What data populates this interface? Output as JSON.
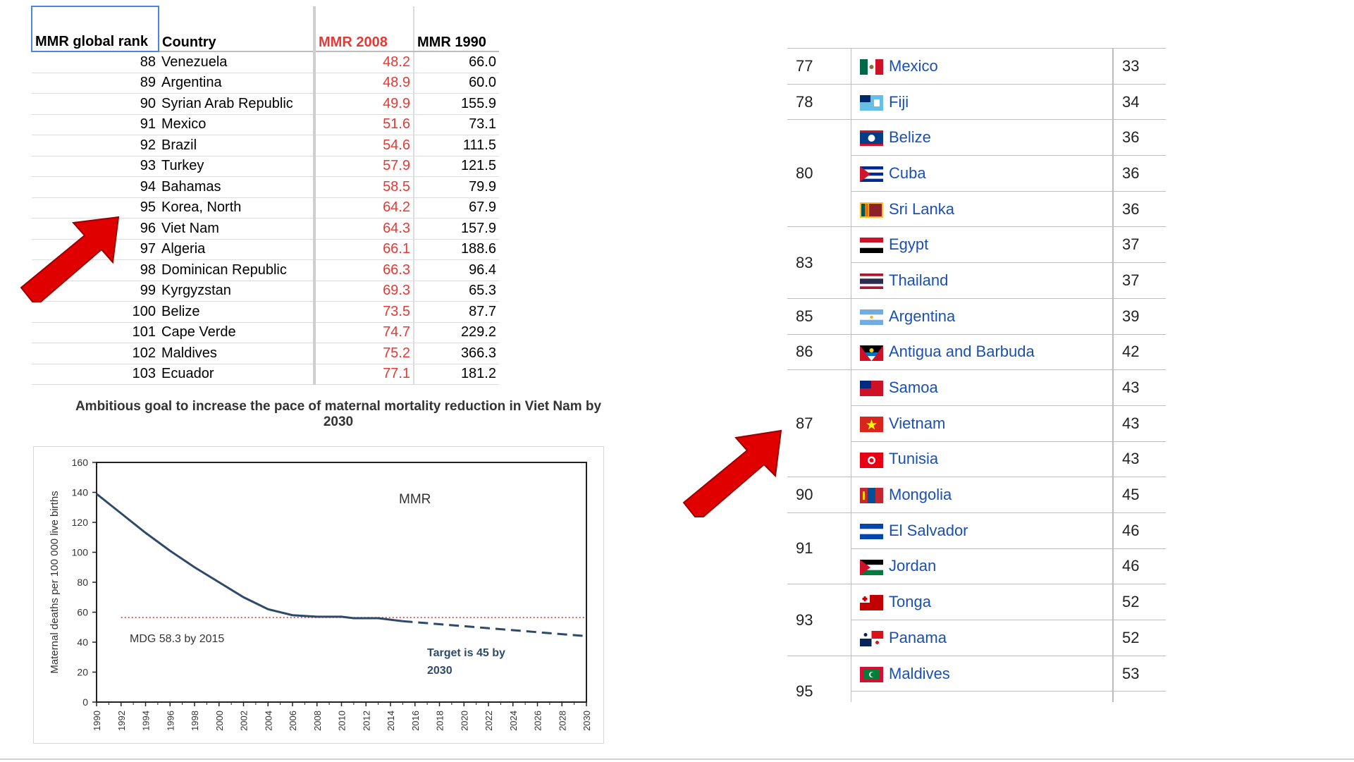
{
  "colors": {
    "red_text": "#e53935",
    "line_actual": "#2d4a6a",
    "line_target": "#2d4a6a",
    "mdg_line": "#c0392b",
    "arrow": "#e00000",
    "link": "#1a4fb5"
  },
  "left_table": {
    "headers": {
      "rank": "MMR global rank",
      "country": "Country",
      "mmr2008": "MMR 2008",
      "mmr1990": "MMR 1990"
    },
    "rows": [
      {
        "rank": "88",
        "country": "Venezuela",
        "mmr2008": "48.2",
        "mmr1990": "66.0"
      },
      {
        "rank": "89",
        "country": "Argentina",
        "mmr2008": "48.9",
        "mmr1990": "60.0"
      },
      {
        "rank": "90",
        "country": "Syrian Arab Republic",
        "mmr2008": "49.9",
        "mmr1990": "155.9"
      },
      {
        "rank": "91",
        "country": "Mexico",
        "mmr2008": "51.6",
        "mmr1990": "73.1"
      },
      {
        "rank": "92",
        "country": "Brazil",
        "mmr2008": "54.6",
        "mmr1990": "111.5"
      },
      {
        "rank": "93",
        "country": "Turkey",
        "mmr2008": "57.9",
        "mmr1990": "121.5"
      },
      {
        "rank": "94",
        "country": "Bahamas",
        "mmr2008": "58.5",
        "mmr1990": "79.9"
      },
      {
        "rank": "95",
        "country": "Korea, North",
        "mmr2008": "64.2",
        "mmr1990": "67.9"
      },
      {
        "rank": "96",
        "country": "Viet Nam",
        "mmr2008": "64.3",
        "mmr1990": "157.9"
      },
      {
        "rank": "97",
        "country": "Algeria",
        "mmr2008": "66.1",
        "mmr1990": "188.6"
      },
      {
        "rank": "98",
        "country": "Dominican Republic",
        "mmr2008": "66.3",
        "mmr1990": "96.4"
      },
      {
        "rank": "99",
        "country": "Kyrgyzstan",
        "mmr2008": "69.3",
        "mmr1990": "65.3"
      },
      {
        "rank": "100",
        "country": "Belize",
        "mmr2008": "73.5",
        "mmr1990": "87.7"
      },
      {
        "rank": "101",
        "country": "Cape Verde",
        "mmr2008": "74.7",
        "mmr1990": "229.2"
      },
      {
        "rank": "102",
        "country": "Maldives",
        "mmr2008": "75.2",
        "mmr1990": "366.3"
      },
      {
        "rank": "103",
        "country": "Ecuador",
        "mmr2008": "77.1",
        "mmr1990": "181.2"
      }
    ]
  },
  "chart_data": {
    "type": "line",
    "title": "Ambitious goal to increase the pace of maternal mortality reduction in Viet Nam by 2030",
    "ylabel": "Maternal deaths per 100 000 live births",
    "xlabel": "",
    "ylim": [
      0,
      160
    ],
    "xlim": [
      1990,
      2030
    ],
    "yticks": [
      0,
      20,
      40,
      60,
      80,
      100,
      120,
      140,
      160
    ],
    "xticks": [
      1990,
      1992,
      1994,
      1996,
      1998,
      2000,
      2002,
      2004,
      2006,
      2008,
      2010,
      2012,
      2014,
      2016,
      2018,
      2020,
      2022,
      2024,
      2026,
      2028,
      2030
    ],
    "series": [
      {
        "name": "MMR",
        "style": "solid",
        "x": [
          1990,
          1992,
          1994,
          1996,
          1998,
          2000,
          2002,
          2004,
          2006,
          2008,
          2010,
          2011,
          2012,
          2013,
          2014,
          2015
        ],
        "y": [
          139,
          126,
          113,
          101,
          90,
          80,
          70,
          62,
          58,
          57,
          57,
          56,
          56,
          56,
          55,
          54
        ]
      },
      {
        "name": "",
        "style": "dashed",
        "x": [
          2015,
          2018,
          2021,
          2024,
          2027,
          2030
        ],
        "y": [
          54,
          52,
          50,
          48,
          46,
          44
        ]
      }
    ],
    "reference_line": {
      "y": 56.5,
      "style": "dotted"
    },
    "annotations": [
      {
        "text": "MMR"
      },
      {
        "text": "MDG 58.3 by 2015"
      },
      {
        "text": "Target is 45 by 2030"
      }
    ],
    "grid": false
  },
  "right_table": {
    "rows": [
      {
        "rank": "77",
        "rowspan": 1,
        "items": [
          {
            "flag": "mexico-flag",
            "country": "Mexico",
            "value": "33"
          }
        ]
      },
      {
        "rank": "78",
        "rowspan": 1,
        "items": [
          {
            "flag": "fiji-flag",
            "country": "Fiji",
            "value": "34"
          }
        ]
      },
      {
        "rank": "80",
        "rowspan": 3,
        "items": [
          {
            "flag": "belize-flag",
            "country": "Belize",
            "value": "36"
          },
          {
            "flag": "cuba-flag",
            "country": "Cuba",
            "value": "36"
          },
          {
            "flag": "sri-lanka-flag",
            "country": "Sri Lanka",
            "value": "36"
          }
        ]
      },
      {
        "rank": "83",
        "rowspan": 2,
        "items": [
          {
            "flag": "egypt-flag",
            "country": "Egypt",
            "value": "37"
          },
          {
            "flag": "thailand-flag",
            "country": "Thailand",
            "value": "37"
          }
        ]
      },
      {
        "rank": "85",
        "rowspan": 1,
        "items": [
          {
            "flag": "argentina-flag",
            "country": "Argentina",
            "value": "39"
          }
        ]
      },
      {
        "rank": "86",
        "rowspan": 1,
        "items": [
          {
            "flag": "antigua-flag",
            "country": "Antigua and Barbuda",
            "value": "42"
          }
        ]
      },
      {
        "rank": "87",
        "rowspan": 3,
        "items": [
          {
            "flag": "samoa-flag",
            "country": "Samoa",
            "value": "43"
          },
          {
            "flag": "vietnam-flag",
            "country": "Vietnam",
            "value": "43"
          },
          {
            "flag": "tunisia-flag",
            "country": "Tunisia",
            "value": "43"
          }
        ]
      },
      {
        "rank": "90",
        "rowspan": 1,
        "items": [
          {
            "flag": "mongolia-flag",
            "country": "Mongolia",
            "value": "45"
          }
        ]
      },
      {
        "rank": "91",
        "rowspan": 2,
        "items": [
          {
            "flag": "el-salvador-flag",
            "country": "El Salvador",
            "value": "46"
          },
          {
            "flag": "jordan-flag",
            "country": "Jordan",
            "value": "46"
          }
        ]
      },
      {
        "rank": "93",
        "rowspan": 2,
        "items": [
          {
            "flag": "tonga-flag",
            "country": "Tonga",
            "value": "52"
          },
          {
            "flag": "panama-flag",
            "country": "Panama",
            "value": "52"
          }
        ]
      },
      {
        "rank": "95",
        "rowspan": 2,
        "items": [
          {
            "flag": "maldives-flag",
            "country": "Maldives",
            "value": "53"
          },
          {
            "flag": "",
            "country": "",
            "value": ""
          }
        ]
      }
    ]
  }
}
